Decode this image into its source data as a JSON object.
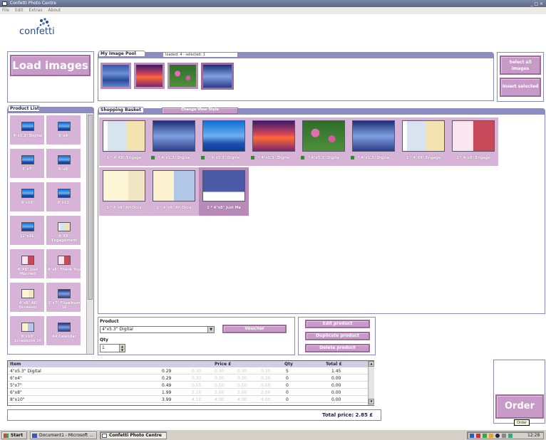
{
  "window": {
    "title": "Confetti Photo Centre",
    "controls": "_ □ ×"
  },
  "menu": [
    "File",
    "Edit",
    "Extras",
    "About"
  ],
  "logo": "confetti",
  "load_images_label": "Load images",
  "image_pool": {
    "tab": "My Image Pool",
    "status": "loaded: 4 - selected: 1",
    "select_all_label": "Select all images",
    "insert_selected_label": "Insert selected"
  },
  "product_list": {
    "tab": "Product List",
    "items": [
      {
        "label": "4\"x5.3\" Digital"
      },
      {
        "label": "6\"x4\""
      },
      {
        "label": "5\"x7\""
      },
      {
        "label": "6\"x8\""
      },
      {
        "label": "8\"x10\""
      },
      {
        "label": "8\"x12\""
      },
      {
        "label": "12\"x16\""
      },
      {
        "label": "4\"X8\" Engagement"
      },
      {
        "label": "4\"X8\" Just Married"
      },
      {
        "label": "4\"x8\" Thank You"
      },
      {
        "label": "4\"x8\" All Occasion"
      },
      {
        "label": "5\"x7\" Flipalbum 16"
      },
      {
        "label": "8\"x10\" Scrapbook 16"
      },
      {
        "label": "A4 Calendar"
      }
    ]
  },
  "basket": {
    "tab": "Shopping Basket",
    "change_view_label": "Change View Style",
    "items": [
      {
        "caption": "1 * 4\"X8\" Engage",
        "thumb": "card"
      },
      {
        "caption": "* 4\"x5.3\" Digita",
        "thumb": "wave"
      },
      {
        "caption": "* 4\"x5.3\" Digita",
        "thumb": "sky"
      },
      {
        "caption": "* 4\"x5.3\" Digita",
        "thumb": "sunset"
      },
      {
        "caption": "* 4\"x5.3\" Digita",
        "thumb": "lily"
      },
      {
        "caption": "* 4\"x5.3\" Digita",
        "thumb": "wave"
      },
      {
        "caption": "1 * 4\"X8\" Engage",
        "thumb": "card"
      },
      {
        "caption": "1 * 4\"x8\" Engage",
        "thumb": "card2"
      },
      {
        "caption": "1 * 4\"x8\" All Occa",
        "thumb": "card4"
      },
      {
        "caption": "1 * 4\"x8\" All Occa",
        "thumb": "card3"
      },
      {
        "caption": "1 * 4\"x8\" Just Ma",
        "thumb": "card5"
      }
    ]
  },
  "product_form": {
    "product_label": "Product",
    "product_value": "4\"x5.3\" Digital",
    "qty_label": "Qty",
    "qty_value": "1",
    "voucher_label": "Voucher",
    "edit_label": "Edit product",
    "duplicate_label": "Duplicate product",
    "delete_label": "Delete product"
  },
  "table": {
    "headers": {
      "item": "Item",
      "price": "Price £",
      "qty": "Qty",
      "total": "Total £"
    },
    "rows": [
      {
        "item": "4\"x5.3\" Digital",
        "price": "0.29",
        "p2": "0.33",
        "p3": "0.30",
        "p4": "0.30",
        "p5": "0.30",
        "qty": "5",
        "total": "1.45"
      },
      {
        "item": "6\"x4\"",
        "price": "0.29",
        "p2": "0.33",
        "p3": "0.30",
        "p4": "0.30",
        "p5": "0.30",
        "qty": "0",
        "total": "0.00"
      },
      {
        "item": "5\"x7\"",
        "price": "0.49",
        "p2": "0.55",
        "p3": "0.50",
        "p4": "0.50",
        "p5": "0.50",
        "qty": "0",
        "total": "0.00"
      },
      {
        "item": "6\"x8\"",
        "price": "1.99",
        "p2": "2.10",
        "p3": "2.00",
        "p4": "2.00",
        "p5": "2.00",
        "qty": "0",
        "total": "0.00"
      },
      {
        "item": "8\"x10\"",
        "price": "3.99",
        "p2": "4.10",
        "p3": "4.00",
        "p4": "4.00",
        "p5": "4.00",
        "qty": "0",
        "total": "0.00"
      }
    ]
  },
  "total_price": "Total price: 2.85 £",
  "order_label": "Order",
  "order_tooltip": "Order",
  "taskbar": {
    "start": "Start",
    "tasks": [
      "Document1 - Microsoft ...",
      "Confetti Photo Centre"
    ],
    "clock": "12:28"
  },
  "colors": {
    "accent": "#c79ac7",
    "frame": "#8e8cc0",
    "cell": "#d7b3d7"
  }
}
